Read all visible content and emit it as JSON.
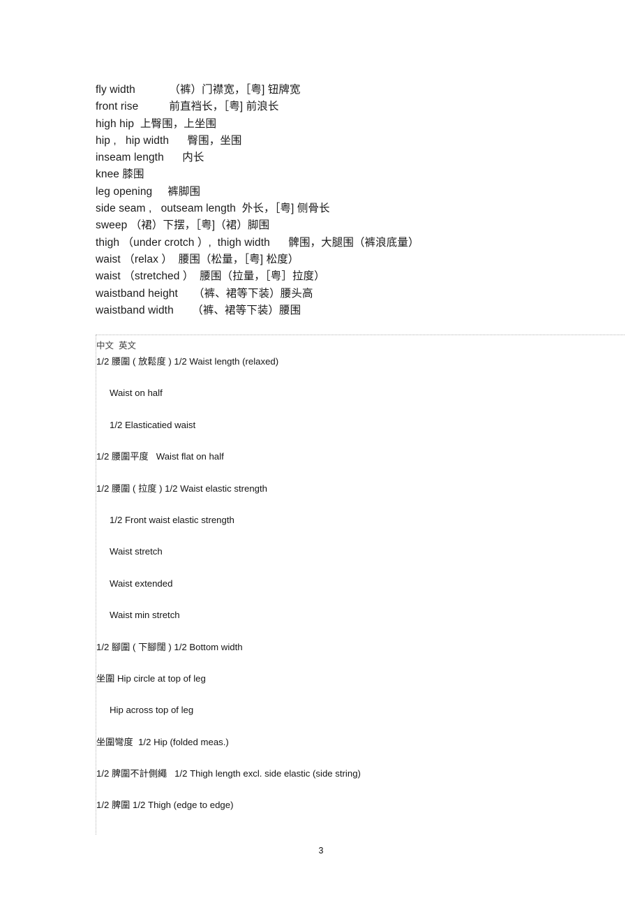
{
  "document": {
    "page_number": "3"
  },
  "glossary": {
    "lines": [
      "fly width           （裤）门襟宽，［粤] 钮牌宽",
      "front rise          前直裆长，［粤] 前浪长",
      "high hip  上臀围，上坐围",
      "hip ,   hip width      臀围，坐围",
      "inseam length      内长",
      "knee 膝围",
      "leg opening     裤脚围",
      "side seam ,   outseam length  外长，［粤] 侧骨长",
      "sweep （裙）下摆，［粤]（裙）脚围",
      "thigh （under crotch ）,  thigh width      髀围，大腿围（裤浪底量）",
      "waist （relax ）  腰围（松量，［粤] 松度）",
      "waist （stretched ）  腰围（拉量，［粤］拉度）",
      "waistband height     （裤、裙等下装）腰头高",
      "waistband width      （裤、裙等下装）腰围"
    ]
  },
  "table": {
    "header": "中文  英文",
    "rows": [
      {
        "text": "1/2 腰圍 ( 放鬆度 ) 1/2 Waist length (relaxed)",
        "indent": 0
      },
      {
        "text": "Waist on half",
        "indent": 1
      },
      {
        "text": "1/2 Elasticatied waist",
        "indent": 1
      },
      {
        "text": "1/2 腰圍平度   Waist flat on half",
        "indent": 0
      },
      {
        "text": "1/2 腰圍 ( 拉度 ) 1/2 Waist elastic strength",
        "indent": 0
      },
      {
        "text": "1/2 Front waist elastic strength",
        "indent": 1
      },
      {
        "text": "Waist stretch",
        "indent": 1
      },
      {
        "text": "Waist extended",
        "indent": 1
      },
      {
        "text": "Waist min stretch",
        "indent": 1
      },
      {
        "text": "1/2 腳圍 ( 下腳闊 ) 1/2 Bottom width",
        "indent": 0
      },
      {
        "text": "坐圍 Hip circle at top of leg",
        "indent": 0
      },
      {
        "text": "Hip across top of leg",
        "indent": 1
      },
      {
        "text": "坐圍彎度  1/2 Hip (folded meas.)",
        "indent": 0
      },
      {
        "text": "1/2 脾圍不計側繩   1/2 Thigh length excl. side elastic (side string)",
        "indent": 0
      },
      {
        "text": "1/2 脾圍 1/2 Thigh (edge to edge)",
        "indent": 0
      }
    ]
  },
  "colors": {
    "text": "#111111",
    "rule": "#b4b4b4",
    "background": "#ffffff"
  }
}
